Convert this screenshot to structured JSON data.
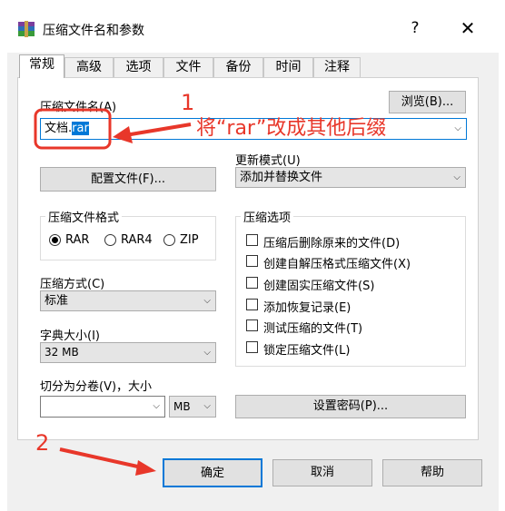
{
  "window": {
    "title": "压缩文件名和参数",
    "help_glyph": "?",
    "close_glyph": "✕"
  },
  "tabs": [
    {
      "label": "常规",
      "active": true
    },
    {
      "label": "高级"
    },
    {
      "label": "选项"
    },
    {
      "label": "文件"
    },
    {
      "label": "备份"
    },
    {
      "label": "时间"
    },
    {
      "label": "注释"
    }
  ],
  "general": {
    "archive_name_label": "压缩文件名(A)",
    "archive_name_base": "文档.",
    "archive_name_ext": "rar",
    "browse_button": "浏览(B)...",
    "update_mode_label": "更新模式(U)",
    "update_mode_value": "添加并替换文件",
    "profile_button": "配置文件(F)...",
    "format_group_title": "压缩文件格式",
    "formats": [
      {
        "label": "RAR",
        "selected": true
      },
      {
        "label": "RAR4",
        "selected": false
      },
      {
        "label": "ZIP",
        "selected": false
      }
    ],
    "options_group_title": "压缩选项",
    "options": [
      "压缩后删除原来的文件(D)",
      "创建自解压格式压缩文件(X)",
      "创建固实压缩文件(S)",
      "添加恢复记录(E)",
      "测试压缩的文件(T)",
      "锁定压缩文件(L)"
    ],
    "method_label": "压缩方式(C)",
    "method_value": "标准",
    "dict_label": "字典大小(I)",
    "dict_value": "32 MB",
    "split_label": "切分为分卷(V)，大小",
    "split_value": "",
    "split_unit": "MB",
    "password_button": "设置密码(P)..."
  },
  "footer": {
    "ok": "确定",
    "cancel": "取消",
    "help": "帮助"
  },
  "annotations": {
    "marker_1": "1",
    "note_1": "将“rar”改成其他后缀",
    "marker_2": "2",
    "color": "#e8372a"
  }
}
